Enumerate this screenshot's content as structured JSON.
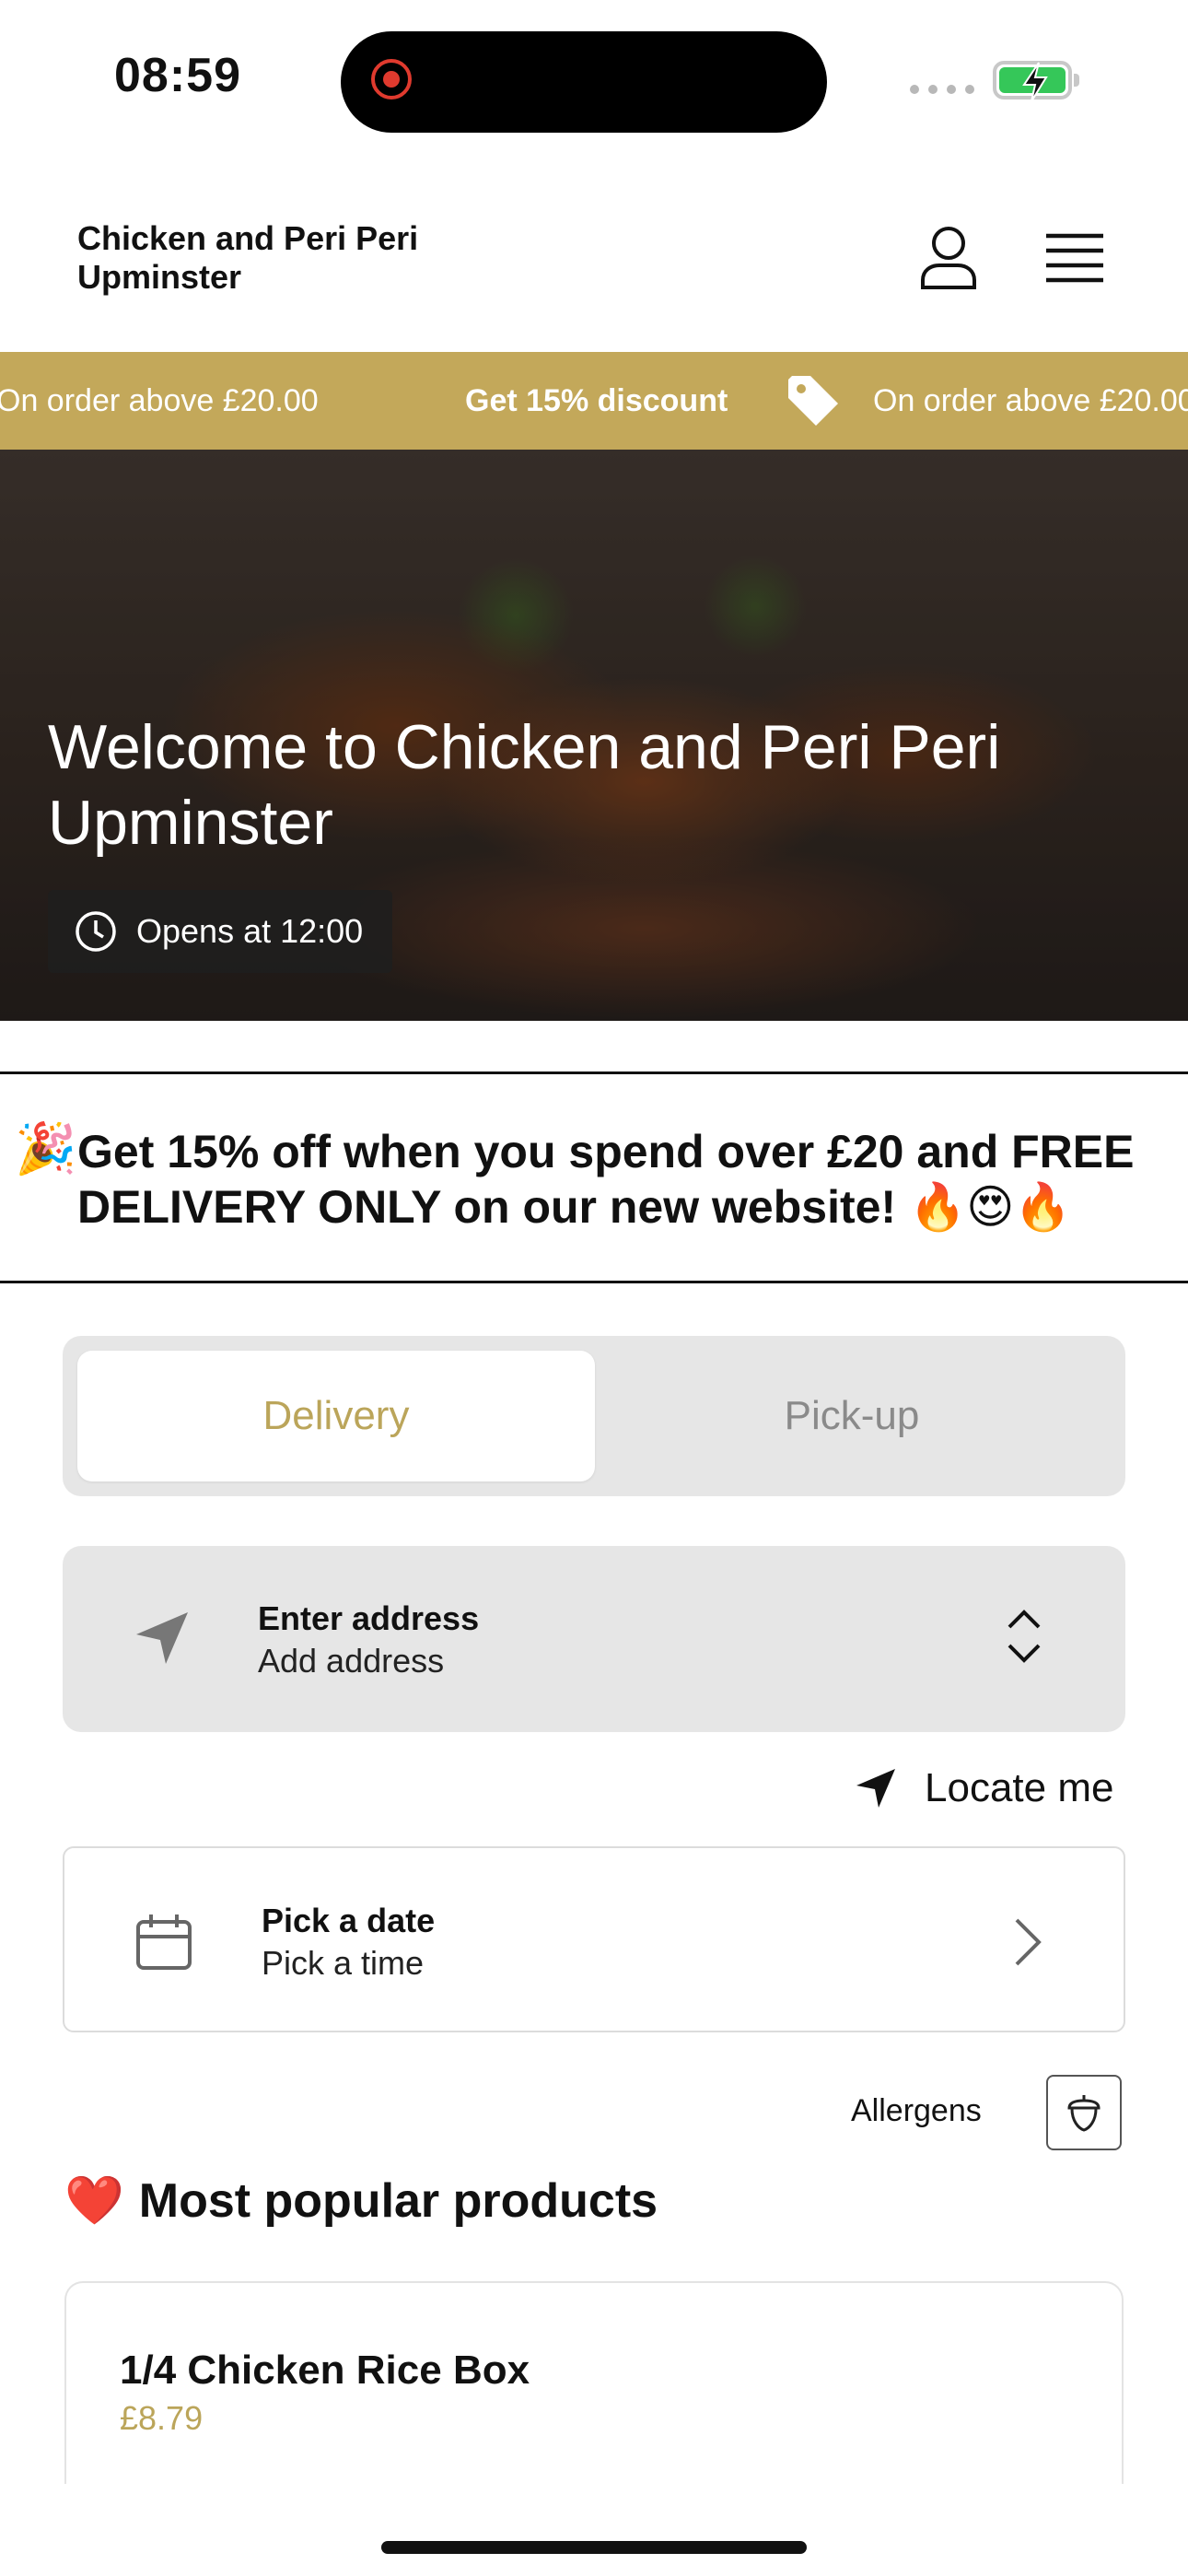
{
  "status_bar": {
    "time": "08:59",
    "icons": [
      "screen-recording-icon",
      "signal-icon",
      "battery-charging-icon"
    ]
  },
  "header": {
    "store_name": "Chicken and Peri Peri Upminster",
    "icons": [
      "user-icon",
      "menu-icon"
    ]
  },
  "promo_strip": {
    "left_text": "On order above £20.00",
    "headline": "Get 15% discount",
    "right_text": "On order above £20.00",
    "icon": "price-tag-icon",
    "color": "#c3a85a"
  },
  "hero": {
    "title": "Welcome to Chicken and Peri Peri Upminster",
    "opens": "Opens at 12:00"
  },
  "announcement": {
    "emoji": "🎉",
    "text": "Get 15% off when you spend over £20  and FREE DELIVERY ONLY on our new website! 🔥😍🔥"
  },
  "order_mode": {
    "options": [
      "Delivery",
      "Pick-up"
    ],
    "selected": "Delivery",
    "accent": "#bba55a"
  },
  "address": {
    "title": "Enter address",
    "subtitle": "Add address"
  },
  "locate": {
    "label": "Locate me"
  },
  "schedule": {
    "title": "Pick a date",
    "subtitle": "Pick a time"
  },
  "allergens": {
    "label": "Allergens"
  },
  "popular": {
    "emoji": "❤️",
    "heading": "Most popular products"
  },
  "products": [
    {
      "name": "1/4 Chicken Rice Box",
      "price": "£8.79"
    }
  ]
}
